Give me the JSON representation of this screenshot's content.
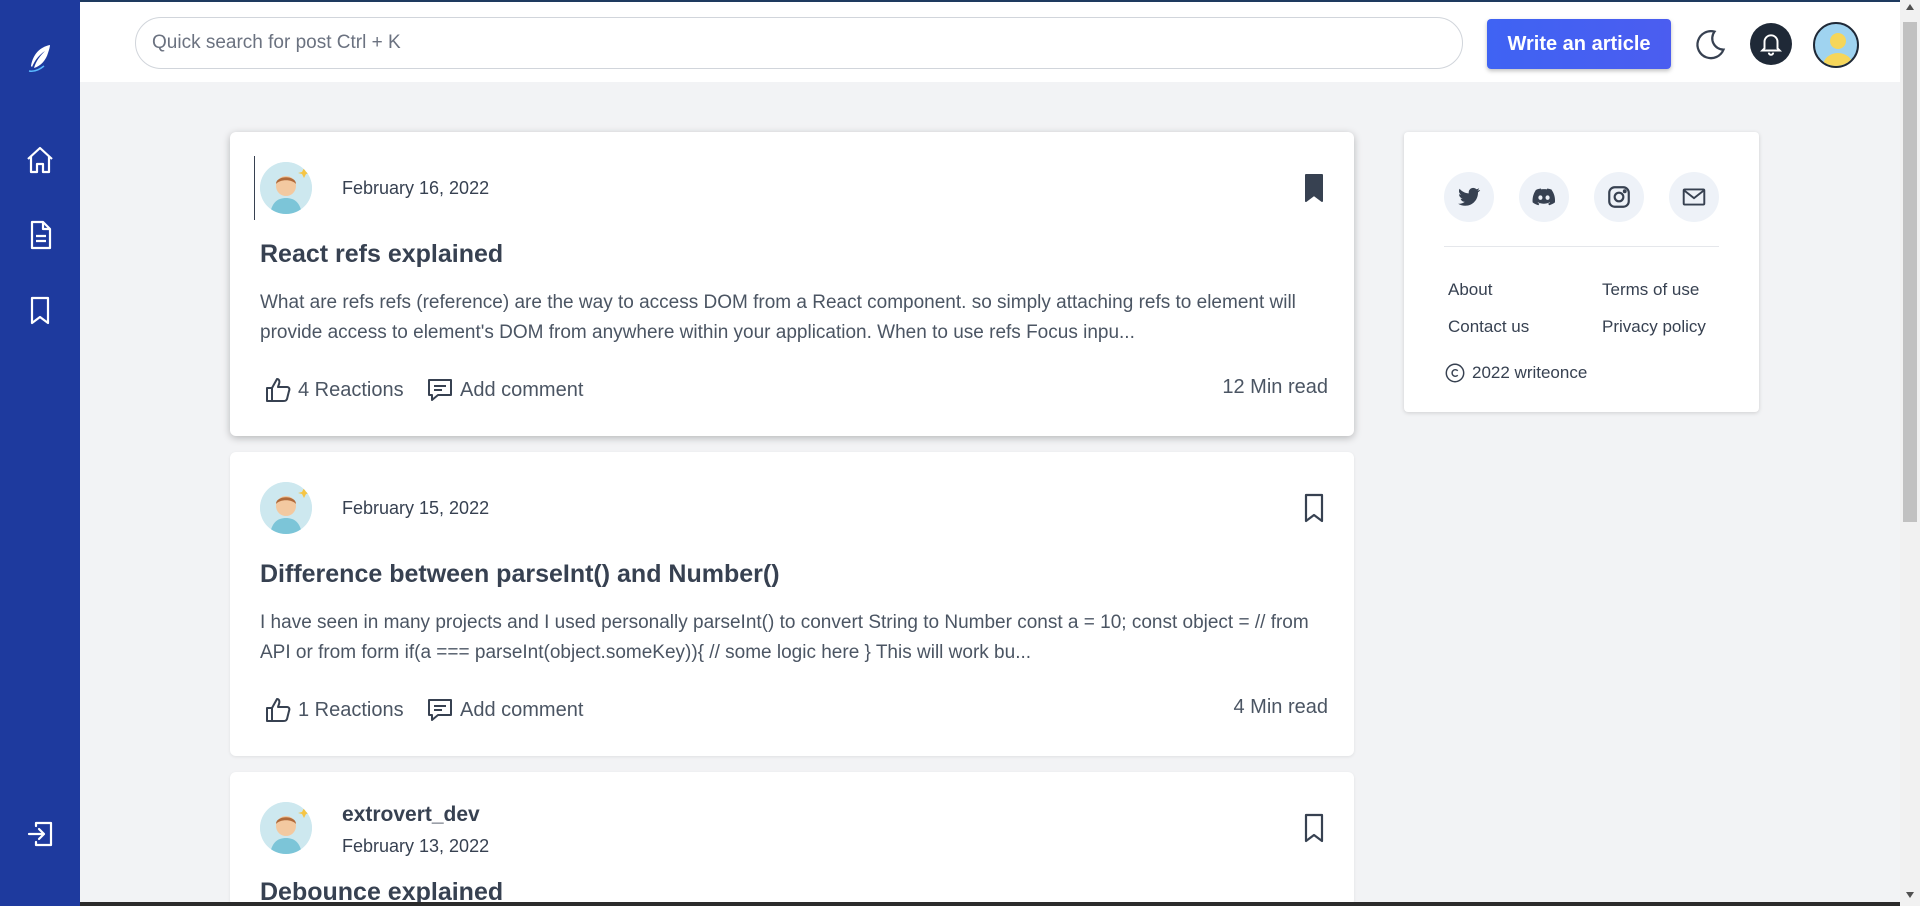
{
  "search": {
    "placeholder": "Quick search for post Ctrl + K"
  },
  "header": {
    "write_label": "Write an article"
  },
  "posts": [
    {
      "date": "February 16, 2022",
      "title": "React refs explained",
      "excerpt": "What are refs refs (reference) are the way to access DOM from a React component. so simply attaching refs to element will provide access to element's DOM from anywhere within your application. When to use refs Focus inpu...",
      "reactions": "4 Reactions",
      "comment": "Add comment",
      "read_time": "12 Min read",
      "bookmarked": true
    },
    {
      "date": "February 15, 2022",
      "title": "Difference between parseInt() and Number()",
      "excerpt": "I have seen in many projects and I used personally parseInt() to convert String to Number const a = 10; const object = // from API or from form if(a === parseInt(object.someKey)){ // some logic here } This will work bu...",
      "reactions": "1 Reactions",
      "comment": "Add comment",
      "read_time": "4 Min read",
      "bookmarked": false
    },
    {
      "author": "extrovert_dev",
      "date": "February 13, 2022",
      "title": "Debounce explained",
      "bookmarked": false
    }
  ],
  "sidebar_panel": {
    "links": [
      "About",
      "Terms of use",
      "Contact us",
      "Privacy policy"
    ],
    "copyright": "2022 writeonce"
  },
  "colors": {
    "sidebar": "#1e3a9e",
    "accent": "#3f63f3"
  }
}
